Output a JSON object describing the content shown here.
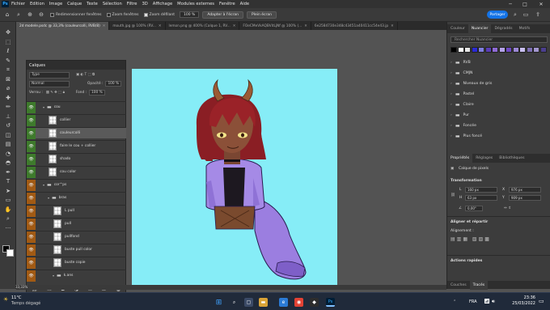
{
  "menubar": {
    "logo": "Ps",
    "items": [
      "Fichier",
      "Edition",
      "Image",
      "Calque",
      "Texte",
      "Sélection",
      "Filtre",
      "3D",
      "Affichage",
      "Modules externes",
      "Fenêtre",
      "Aide"
    ]
  },
  "options": {
    "resize_windows": "Redimensionner fenêtres",
    "zoom_all": "Zoom fenêtres",
    "scrubby_zoom": "Zoom défilant",
    "zoom_value": "100 %",
    "fit_screen": "Adapter à l'écran",
    "fill_screen": "Plein écran",
    "share": "Partager"
  },
  "tabs": [
    {
      "label": "2d modele.psdc @ 33,3% (couleurcolli, RVB/8)",
      "active": true
    },
    {
      "label": "mouth.jpg @ 100% (RV...",
      "active": false
    },
    {
      "label": "lemon.png @ 400% (Calque 1, RV...",
      "active": false
    },
    {
      "label": "FOeCMeVkAQBVitLjNf @ 100% (...",
      "active": false
    },
    {
      "label": "6e2584730e348c43451a40411cc54e43.jp",
      "active": false
    }
  ],
  "layers": {
    "title": "Calques",
    "filter": "Type",
    "blend_mode": "Normal",
    "opacity_label": "Opacité :",
    "opacity_value": "100 %",
    "lock_label": "Verrou :",
    "fill_label": "Fond :",
    "fill_value": "100 %",
    "items": [
      {
        "name": "cou",
        "kind": "group",
        "eye": "green",
        "selected": false
      },
      {
        "name": "collier",
        "kind": "layer",
        "eye": "green",
        "selected": false
      },
      {
        "name": "couleurcolli",
        "kind": "layer",
        "eye": "green",
        "selected": true
      },
      {
        "name": "faire le cou + collier",
        "kind": "layer",
        "eye": "green",
        "selected": false
      },
      {
        "name": "shado",
        "kind": "layer",
        "eye": "green",
        "selected": false
      },
      {
        "name": "cou color",
        "kind": "layer",
        "eye": "green",
        "selected": false
      },
      {
        "name": "cor^ps",
        "kind": "group",
        "eye": "orange",
        "selected": false
      },
      {
        "name": "bras",
        "kind": "group",
        "eye": "orange",
        "selected": false
      },
      {
        "name": "L pull",
        "kind": "layer",
        "eye": "orange",
        "selected": false
      },
      {
        "name": "pull",
        "kind": "layer",
        "eye": "orange",
        "selected": false
      },
      {
        "name": "pullfond",
        "kind": "layer",
        "eye": "orange",
        "selected": false
      },
      {
        "name": "buste pull color",
        "kind": "layer",
        "eye": "orange",
        "selected": false
      },
      {
        "name": "buste copie",
        "kind": "layer",
        "eye": "orange",
        "selected": false
      },
      {
        "name": "k.ans",
        "kind": "group",
        "eye": "orange",
        "selected": false
      }
    ]
  },
  "swatches_panel": {
    "tabs": [
      "Couleur",
      "Nuancier",
      "Dégradés",
      "Motifs"
    ],
    "active_tab": "Nuancier",
    "search_placeholder": "Rechercher Nuancier",
    "colors": [
      "#000000",
      "#ffffff",
      "#e5e5e5",
      "#2b2ad4",
      "#7f7fe0",
      "#5a3db6",
      "#8f6bd6",
      "#b4a2e8",
      "#6e49c1",
      "#9c88d5",
      "#c9bff0",
      "#7d6fb3",
      "#a397cf",
      "#4c3f8f"
    ],
    "groups": [
      "RVB",
      "CMJN",
      "Niveaux de gris",
      "Pastel",
      "Claire",
      "Pur",
      "Foncée",
      "Plus foncé"
    ]
  },
  "properties_panel": {
    "tabs": [
      "Propriétés",
      "Réglages",
      "Bibliothèques"
    ],
    "active_tab": "Propriétés",
    "layer_type": "Calque de pixels",
    "transform_title": "Transformation",
    "W": "160 px",
    "H": "63 px",
    "X": "976 px",
    "Y": "909 px",
    "angle": "0,00°",
    "align_title": "Aligner et répartir",
    "align_label": "Alignement :",
    "quick_actions": "Actions rapides"
  },
  "bottom_tabs": [
    "Couches",
    "Tracés"
  ],
  "status": {
    "zoom": "33,33%"
  },
  "taskbar": {
    "temp": "11°C",
    "weather": "Temps dégagé",
    "lang": "FRA",
    "time": "23:36",
    "date": "25/03/2022"
  }
}
